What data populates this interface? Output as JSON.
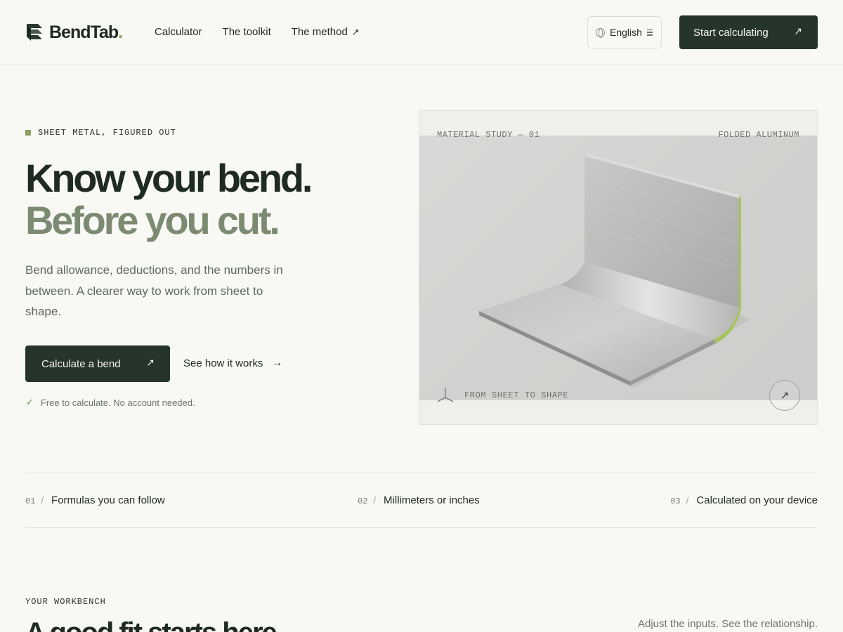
{
  "header": {
    "logo_text": "BendTab",
    "logo_dot": ".",
    "nav": [
      {
        "label": "Calculator"
      },
      {
        "label": "The toolkit"
      },
      {
        "label": "The method",
        "ext_icon": "arrow-up-right-icon"
      }
    ],
    "language": "English",
    "cta": "Start calculating"
  },
  "hero": {
    "eyebrow": "SHEET METAL, FIGURED OUT",
    "headline_1": "Know your bend.",
    "headline_2": "Before you cut.",
    "lead": "Bend allowance, deductions, and the numbers in between. A clearer way to work from sheet to shape.",
    "primary_button": "Calculate a bend",
    "secondary_link": "See how it works",
    "note": "Free to calculate. No account needed."
  },
  "card": {
    "label_left": "MATERIAL STUDY — 01",
    "label_right": "FOLDED ALUMINUM",
    "footer": "FROM SHEET TO SHAPE"
  },
  "features": [
    {
      "num": "01",
      "label": "Formulas you can follow"
    },
    {
      "num": "02",
      "label": "Millimeters or inches"
    },
    {
      "num": "03",
      "label": "Calculated on your device"
    }
  ],
  "workbench": {
    "eyebrow": "YOUR WORKBENCH",
    "title": "A good fit starts here",
    "subtitle": "Adjust the inputs. See the relationship."
  },
  "colors": {
    "accent": "#8aa05a",
    "dark": "#26352b",
    "muted_headline": "#7c8a72",
    "background": "#f8f8f5"
  }
}
